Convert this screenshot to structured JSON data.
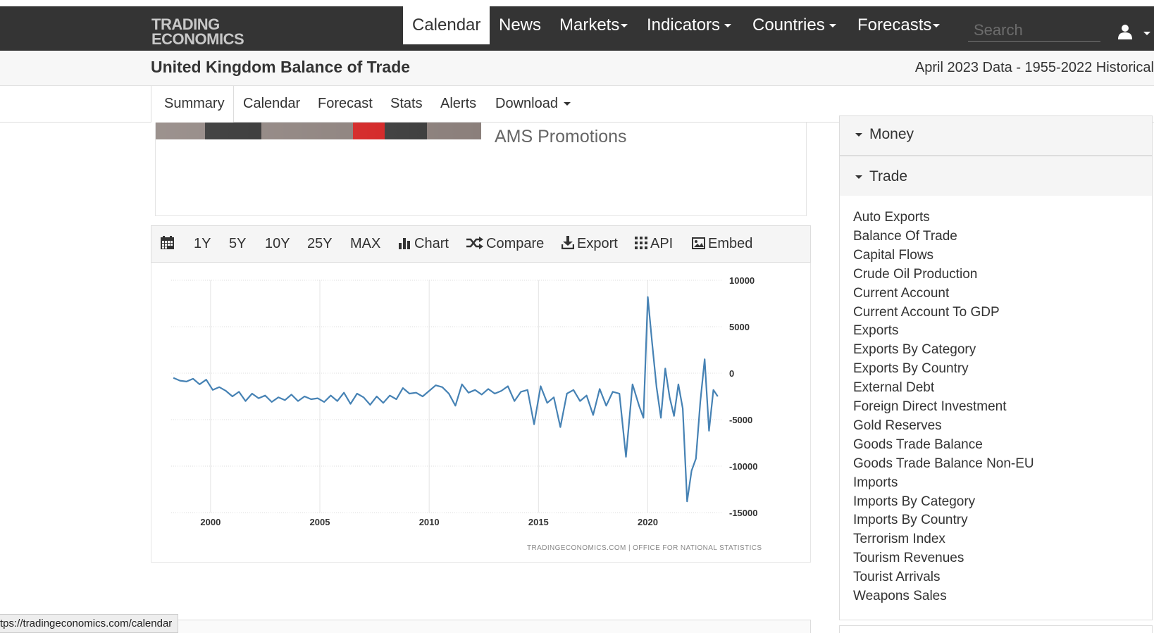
{
  "brand": {
    "line1": "TRADING",
    "line2": "ECONOMICS"
  },
  "nav": {
    "items": [
      {
        "label": "Calendar",
        "active": true,
        "dropdown": false
      },
      {
        "label": "News",
        "dropdown": false
      },
      {
        "label": "Markets",
        "dropdown": true
      },
      {
        "label": "Indicators",
        "dropdown": true
      },
      {
        "label": "Countries",
        "dropdown": true
      },
      {
        "label": "Forecasts",
        "dropdown": true
      }
    ],
    "search_placeholder": "Search",
    "user_icon": "user-icon"
  },
  "header": {
    "title": "United Kingdom Balance of Trade",
    "subtitle": "April 2023 Data - 1955-2022 Historical"
  },
  "tabs": [
    {
      "label": "Summary",
      "active": true
    },
    {
      "label": "Calendar"
    },
    {
      "label": "Forecast"
    },
    {
      "label": "Stats"
    },
    {
      "label": "Alerts"
    },
    {
      "label": "Download",
      "dropdown": true
    }
  ],
  "ad": {
    "text": "AMS Promotions"
  },
  "chart_toolbar": {
    "calendar_icon": "calendar-icon",
    "ranges": [
      "1Y",
      "5Y",
      "10Y",
      "25Y",
      "MAX"
    ],
    "chart_label": "Chart",
    "compare_label": "Compare",
    "export_label": "Export",
    "api_label": "API",
    "embed_label": "Embed"
  },
  "chart_data": {
    "type": "line",
    "title": "",
    "xlabel": "",
    "ylabel": "",
    "x_ticks": [
      2000,
      2005,
      2010,
      2015,
      2020
    ],
    "y_ticks": [
      10000,
      5000,
      0,
      -5000,
      -10000,
      -15000
    ],
    "ylim": [
      -15000,
      10000
    ],
    "xlim": [
      1998.2,
      2023.4
    ],
    "grid": true,
    "y_axis_side": "right",
    "credit": "TRADINGECONOMICS.COM  |  OFFICE FOR NATIONAL STATISTICS",
    "color": "#4682b4",
    "series": [
      {
        "x": [
          1998.3,
          1998.6,
          1998.9,
          1999.2,
          1999.5,
          1999.8,
          2000.1,
          2000.4,
          2000.7,
          2001.0,
          2001.3,
          2001.6,
          2001.9,
          2002.2,
          2002.5,
          2002.8,
          2003.1,
          2003.4,
          2003.7,
          2004.0,
          2004.3,
          2004.6,
          2004.9,
          2005.2,
          2005.5,
          2005.8,
          2006.1,
          2006.4,
          2006.7,
          2007.0,
          2007.3,
          2007.6,
          2007.9,
          2008.2,
          2008.5,
          2008.8,
          2009.1,
          2009.4,
          2009.7,
          2010.0,
          2010.3,
          2010.6,
          2010.9,
          2011.2,
          2011.5,
          2011.8,
          2012.1,
          2012.4,
          2012.7,
          2013.0,
          2013.3,
          2013.6,
          2013.9,
          2014.2,
          2014.5,
          2014.8,
          2015.1,
          2015.4,
          2015.7,
          2016.0,
          2016.3,
          2016.6,
          2016.9,
          2017.2,
          2017.5,
          2017.8,
          2018.1,
          2018.4,
          2018.7,
          2019.0,
          2019.3,
          2019.6,
          2019.8,
          2020.0,
          2020.2,
          2020.4,
          2020.6,
          2020.8,
          2021.0,
          2021.2,
          2021.4,
          2021.6,
          2021.8,
          2022.0,
          2022.2,
          2022.4,
          2022.6,
          2022.8,
          2023.0,
          2023.2
        ],
        "y": [
          -500,
          -800,
          -900,
          -600,
          -1200,
          -700,
          -1800,
          -1500,
          -1900,
          -2500,
          -2000,
          -3000,
          -2200,
          -2700,
          -2400,
          -3100,
          -2600,
          -2900,
          -2300,
          -3000,
          -2500,
          -2800,
          -2700,
          -3100,
          -2400,
          -3000,
          -2100,
          -3300,
          -2200,
          -2600,
          -3400,
          -2500,
          -3200,
          -2400,
          -2800,
          -1600,
          -2200,
          -2100,
          -2500,
          -1900,
          -1300,
          -1500,
          -2200,
          -3500,
          -1200,
          -2100,
          -1800,
          -2300,
          -1700,
          -2200,
          -1900,
          -1400,
          -3000,
          -2000,
          -1800,
          -5500,
          -1400,
          -3200,
          -2600,
          -5800,
          -2200,
          -1800,
          -3000,
          -2400,
          -4500,
          -1700,
          -3500,
          -2000,
          -2200,
          -9000,
          -1200,
          -3500,
          -4800,
          8200,
          3200,
          -1500,
          -4800,
          500,
          -2600,
          -4600,
          -1200,
          -3800,
          -13800,
          -10500,
          -9200,
          -3100,
          1500,
          -6200,
          -1800,
          -2500
        ]
      }
    ]
  },
  "status_url": "tps://tradingeconomics.com/calendar",
  "sidebar": {
    "money_label": "Money",
    "trade_label": "Trade",
    "links": [
      "Auto Exports",
      "Balance Of Trade",
      "Capital Flows",
      "Crude Oil Production",
      "Current Account",
      "Current Account To GDP",
      "Exports",
      "Exports By Category",
      "Exports By Country",
      "External Debt",
      "Foreign Direct Investment",
      "Gold Reserves",
      "Goods Trade Balance",
      "Goods Trade Balance Non-EU",
      "Imports",
      "Imports By Category",
      "Imports By Country",
      "Terrorism Index",
      "Tourism Revenues",
      "Tourist Arrivals",
      "Weapons Sales"
    ]
  }
}
